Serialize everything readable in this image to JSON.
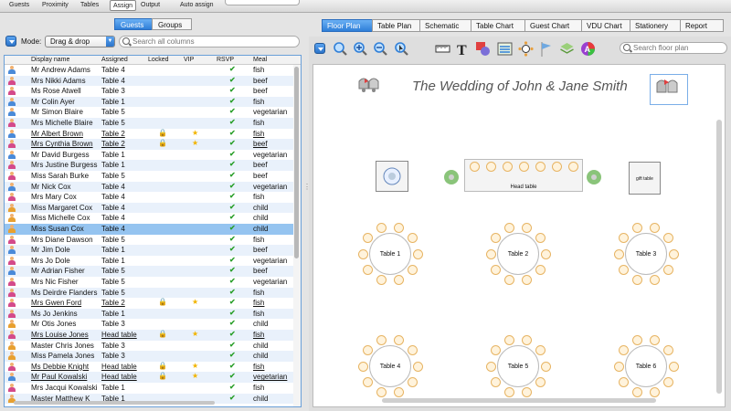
{
  "toolbar": {
    "items": [
      "Guests",
      "Proximity",
      "Tables",
      "Assign",
      "Output",
      "Auto assign"
    ],
    "active": "Assign"
  },
  "left_tabs": [
    "Guests",
    "Groups"
  ],
  "mode": {
    "label": "Mode:",
    "value": "Drag & drop"
  },
  "search": {
    "placeholder": "Search all columns"
  },
  "columns": [
    "Display name",
    "Assigned",
    "Locked",
    "VIP",
    "RSVP",
    "Meal"
  ],
  "guests": [
    {
      "name": "Mr Andrew Adams",
      "table": "Table 4",
      "meal": "fish",
      "type": "m"
    },
    {
      "name": "Mrs Nikki Adams",
      "table": "Table 4",
      "meal": "beef",
      "type": "f"
    },
    {
      "name": "Ms Rose Atwell",
      "table": "Table 3",
      "meal": "beef",
      "type": "f"
    },
    {
      "name": "Mr Colin Ayer",
      "table": "Table 1",
      "meal": "fish",
      "type": "m"
    },
    {
      "name": "Mr Simon Blaire",
      "table": "Table 5",
      "meal": "vegetarian",
      "type": "m"
    },
    {
      "name": "Mrs Michelle Blaire",
      "table": "Table 5",
      "meal": "fish",
      "type": "f"
    },
    {
      "name": "Mr Albert Brown",
      "table": "Table 2",
      "meal": "fish",
      "type": "m",
      "locked": true,
      "vip": true
    },
    {
      "name": "Mrs Cynthia Brown",
      "table": "Table 2",
      "meal": "beef",
      "type": "f",
      "locked": true,
      "vip": true
    },
    {
      "name": "Mr David Burgess",
      "table": "Table 1",
      "meal": "vegetarian",
      "type": "m"
    },
    {
      "name": "Mrs Justine Burgess",
      "table": "Table 1",
      "meal": "beef",
      "type": "f"
    },
    {
      "name": "Miss Sarah Burke",
      "table": "Table 5",
      "meal": "beef",
      "type": "f"
    },
    {
      "name": "Mr Nick Cox",
      "table": "Table 4",
      "meal": "vegetarian",
      "type": "m"
    },
    {
      "name": "Mrs Mary Cox",
      "table": "Table 4",
      "meal": "fish",
      "type": "f"
    },
    {
      "name": "Miss Margaret Cox",
      "table": "Table 4",
      "meal": "child",
      "type": "c"
    },
    {
      "name": "Miss Michelle Cox",
      "table": "Table 4",
      "meal": "child",
      "type": "c"
    },
    {
      "name": "Miss Susan Cox",
      "table": "Table 4",
      "meal": "child",
      "type": "c",
      "selected": true
    },
    {
      "name": "Mrs Diane Dawson",
      "table": "Table 5",
      "meal": "fish",
      "type": "f"
    },
    {
      "name": "Mr Jim Dole",
      "table": "Table 1",
      "meal": "beef",
      "type": "m"
    },
    {
      "name": "Mrs Jo Dole",
      "table": "Table 1",
      "meal": "vegetarian",
      "type": "f"
    },
    {
      "name": "Mr Adrian Fisher",
      "table": "Table 5",
      "meal": "beef",
      "type": "m"
    },
    {
      "name": "Mrs Nic Fisher",
      "table": "Table 5",
      "meal": "vegetarian",
      "type": "f"
    },
    {
      "name": "Ms Deirdre Flanders",
      "table": "Table 5",
      "meal": "fish",
      "type": "f"
    },
    {
      "name": "Mrs Gwen Ford",
      "table": "Table 2",
      "meal": "fish",
      "type": "f",
      "locked": true,
      "vip": true
    },
    {
      "name": "Ms Jo Jenkins",
      "table": "Table 1",
      "meal": "fish",
      "type": "f"
    },
    {
      "name": "Mr Otis Jones",
      "table": "Table 3",
      "meal": "child",
      "type": "c"
    },
    {
      "name": "Mrs Louise Jones",
      "table": "Head table",
      "meal": "fish",
      "type": "f",
      "locked": true,
      "vip": true
    },
    {
      "name": "Master Chris Jones",
      "table": "Table 3",
      "meal": "child",
      "type": "c"
    },
    {
      "name": "Miss Pamela Jones",
      "table": "Table 3",
      "meal": "child",
      "type": "c"
    },
    {
      "name": "Ms Debbie Knight",
      "table": "Head table",
      "meal": "fish",
      "type": "f",
      "locked": true,
      "vip": true
    },
    {
      "name": "Mr Paul Kowalski",
      "table": "Head table",
      "meal": "vegetarian",
      "type": "m",
      "locked": true,
      "vip": true
    },
    {
      "name": "Mrs Jacqui Kowalski",
      "table": "Table 1",
      "meal": "fish",
      "type": "f"
    },
    {
      "name": "Master Matthew K",
      "table": "Table 1",
      "meal": "child",
      "type": "c"
    }
  ],
  "plan_tabs": [
    "Floor Plan",
    "Table Plan",
    "Schematic",
    "Table Chart",
    "Guest Chart",
    "VDU Chart",
    "Stationery",
    "Report"
  ],
  "plan_search": {
    "placeholder": "Search floor plan"
  },
  "plan": {
    "title": "The Wedding of John & Jane Smith",
    "head_table": "Head table",
    "gift_table": "gift table",
    "tables": [
      "Table 1",
      "Table 2",
      "Table 3",
      "Table 4",
      "Table 5",
      "Table 6"
    ]
  },
  "colors": {
    "accent": "#2f7fd8",
    "selected_row": "#95c4f0",
    "alt_row": "#e9f1fb",
    "rsvp": "#2ca02c",
    "chair": "#fff3dc"
  }
}
